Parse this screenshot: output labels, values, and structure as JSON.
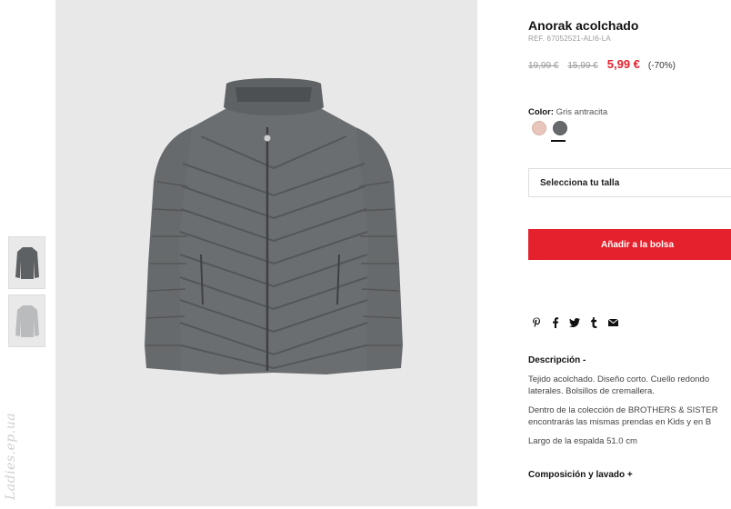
{
  "watermark": "Ladies.ep.ua",
  "product": {
    "title": "Anorak acolchado",
    "ref": "REF. 67052521-ALI6-LA",
    "prices": {
      "original": "19,99 €",
      "previous": "15,99 €",
      "current": "5,99 €",
      "discount": "(-70%)"
    },
    "color_label": "Color:",
    "color_value": "Gris antracita",
    "colors": [
      "#e8c6bb",
      "#676a6c"
    ],
    "size_select": "Selecciona tu talla",
    "add_button": "Añadir a la bolsa",
    "share_icons": [
      "pinterest-icon",
      "facebook-icon",
      "twitter-icon",
      "tumblr-icon",
      "mail-icon"
    ],
    "description_title": "Descripción -",
    "description": [
      "Tejido acolchado. Diseño corto. Cuello redondo",
      "laterales. Bolsillos de cremallera.",
      "Dentro de la colección de BROTHERS & SISTER",
      "encontrarás las mismas prendas en Kids y en B",
      "Largo de la espalda 51.0 cm"
    ],
    "composition_title": "Composición y lavado +"
  },
  "colors": {
    "accent": "#e4212c",
    "jacket": "#6b6e71"
  }
}
